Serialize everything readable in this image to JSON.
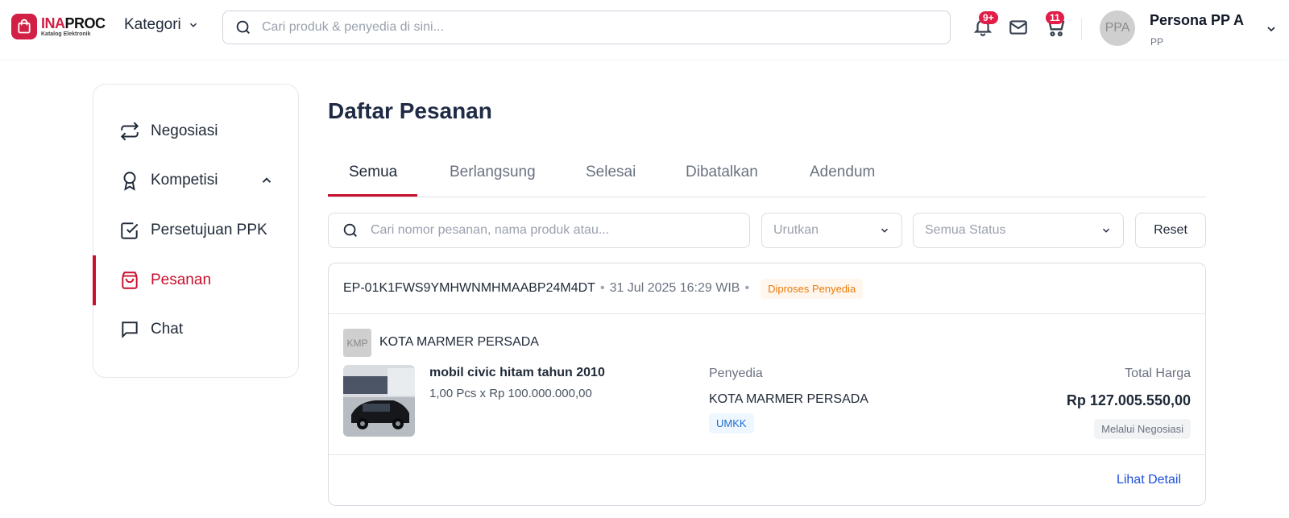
{
  "header": {
    "logo": {
      "brand_a": "INA",
      "brand_b": "PROC",
      "subtitle": "Katalog Elektronik"
    },
    "kategori_label": "Kategori",
    "search_placeholder": "Cari produk & penyedia di sini...",
    "notifications_badge": "9+",
    "cart_badge": "11",
    "user": {
      "initials": "PPA",
      "name": "Persona PP A",
      "role": "PP"
    }
  },
  "sidebar": {
    "items": [
      {
        "label": "Negosiasi",
        "icon": "repeat-icon"
      },
      {
        "label": "Kompetisi",
        "icon": "award-icon",
        "expanded": true
      },
      {
        "label": "Persetujuan PPK",
        "icon": "checkbox-icon"
      },
      {
        "label": "Pesanan",
        "icon": "shopping-bag-icon",
        "active": true
      },
      {
        "label": "Chat",
        "icon": "chat-icon"
      }
    ]
  },
  "main": {
    "title": "Daftar Pesanan",
    "tabs": [
      {
        "label": "Semua",
        "active": true
      },
      {
        "label": "Berlangsung"
      },
      {
        "label": "Selesai"
      },
      {
        "label": "Dibatalkan"
      },
      {
        "label": "Adendum"
      }
    ],
    "filters": {
      "search_placeholder": "Cari nomor pesanan, nama produk atau...",
      "sort_placeholder": "Urutkan",
      "status_placeholder": "Semua Status",
      "reset_label": "Reset"
    },
    "orders": [
      {
        "id": "EP-01K1FWS9YMHWNMHMAABP24M4DT",
        "date": "31 Jul 2025 16:29 WIB",
        "status": "Diproses Penyedia",
        "vendor_initials": "KMP",
        "vendor_name": "KOTA MARMER PERSADA",
        "product_name": "mobil civic hitam tahun 2010",
        "product_qty": "1,00 Pcs x Rp 100.000.000,00",
        "provider_label": "Penyedia",
        "provider_name": "KOTA MARMER PERSADA",
        "provider_tag": "UMKK",
        "total_label": "Total Harga",
        "total_value": "Rp 127.005.550,00",
        "method": "Melalui Negosiasi",
        "detail_link": "Lihat Detail"
      }
    ]
  },
  "colors": {
    "brand": "#d11f45",
    "active": "#c8102e",
    "link": "#1d4ed8",
    "status_orange": "#ea7a0c"
  }
}
